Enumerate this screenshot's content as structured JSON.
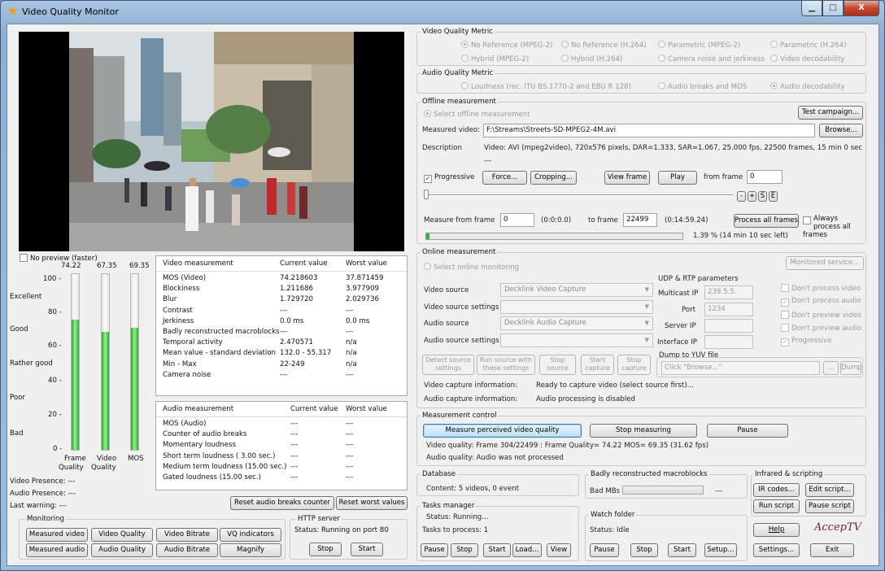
{
  "window": {
    "title": "Video Quality Monitor",
    "min": "▁",
    "max": "□",
    "close": "X"
  },
  "preview": {
    "no_preview_label": "No preview (faster)",
    "no_preview_checked": false
  },
  "gauges": {
    "values": [
      {
        "label": "74.22",
        "caption": "Frame Quality",
        "level": 0.7422
      },
      {
        "label": "67.35",
        "caption": "Video Quality",
        "level": 0.6735
      },
      {
        "label": "69.35",
        "caption": "MOS",
        "level": 0.6935
      }
    ],
    "ticks": [
      "100 -",
      "80 -",
      "60 -",
      "40 -",
      "20 -",
      "0 -"
    ],
    "bands": [
      "Excellent",
      "Good",
      "Rather good",
      "Poor",
      "Bad"
    ],
    "captions": {
      "frame": "Frame",
      "quality1": "Quality",
      "video": "Video",
      "quality2": "Quality",
      "mos": "MOS"
    }
  },
  "presence": {
    "video": "Video Presence:   ---",
    "audio": "Audio Presence:   ---",
    "warning": "Last warning:      ---"
  },
  "video_table": {
    "headers": [
      "Video measurement",
      "Current value",
      "Worst value"
    ],
    "rows": [
      [
        "MOS (Video)",
        "74.218603",
        "37.871459"
      ],
      [
        "Blockiness",
        "1.211686",
        "3.977909"
      ],
      [
        "Blur",
        "1.729720",
        "2.029736"
      ],
      [
        "Contrast",
        "---",
        "---"
      ],
      [
        "Jerkiness",
        "0.0 ms",
        "0.0 ms"
      ],
      [
        "Badly reconstructed macroblocks",
        "---",
        "---"
      ],
      [
        "Temporal activity",
        "2.470571",
        "n/a"
      ],
      [
        "Mean value - standard deviation",
        "132.0 - 55.317",
        "n/a"
      ],
      [
        "Min - Max",
        "22-249",
        "n/a"
      ],
      [
        "Camera noise",
        "---",
        "---"
      ]
    ]
  },
  "audio_table": {
    "headers": [
      "Audio measurement",
      "Current value",
      "Worst value"
    ],
    "rows": [
      [
        "MOS (Audio)",
        "---",
        "---"
      ],
      [
        "Counter of audio breaks",
        "---",
        "---"
      ],
      [
        "Momentary loudness",
        "---",
        "---"
      ],
      [
        "Short term loudness ( 3.00 sec.)",
        "---",
        "---"
      ],
      [
        "Medium term loudness (15.00 sec.)",
        "---",
        "---"
      ],
      [
        "Gated loudness (15.00 sec.)",
        "---",
        "---"
      ]
    ]
  },
  "reset": {
    "audio_breaks": "Reset audio breaks counter",
    "worst": "Reset worst values"
  },
  "monitoring": {
    "title": "Monitoring",
    "row1": [
      "Measured video",
      "Video Quality",
      "Video Bitrate",
      "VQ indicators"
    ],
    "row2": [
      "Measured audio",
      "Audio Quality",
      "Audio Bitrate",
      "Magnify"
    ]
  },
  "http": {
    "title": "HTTP server",
    "status": "Status:  Running on port 80",
    "stop": "Stop",
    "start": "Start"
  },
  "vqm": {
    "title": "Video Quality Metric",
    "options": [
      {
        "label": "No Reference (MPEG-2)",
        "on": true
      },
      {
        "label": "No Reference (H.264)",
        "on": false
      },
      {
        "label": "Parametric (MPEG-2)",
        "on": false
      },
      {
        "label": "Parametric (H.264)",
        "on": false
      },
      {
        "label": "Hybrid (MPEG-2)",
        "on": false
      },
      {
        "label": "Hybrid (H.264)",
        "on": false
      },
      {
        "label": "Camera noise and jerkiness",
        "on": false
      },
      {
        "label": "Video decodability",
        "on": false
      }
    ]
  },
  "aqm": {
    "title": "Audio Quality Metric",
    "options": [
      {
        "label": "Loudness (rec. ITU BS.1770-2 and EBU R 128)",
        "on": false
      },
      {
        "label": "Audio breaks and MOS",
        "on": false
      },
      {
        "label": "Audio decodability",
        "on": true
      }
    ]
  },
  "offline": {
    "title": "Offline measurement",
    "select": "Select offline measurement",
    "test_campaign": "Test campaign...",
    "measured_video_label": "Measured video:",
    "measured_video": "F:\\Streams\\Streets-SD-MPEG2-4M.avi",
    "browse": "Browse...",
    "description_label": "Description",
    "description": "Video: AVI (mpeg2video), 720x576 pixels, DAR=1.333, SAR=1.067,  25.000 fps, 22500 frames, 15 min 0 sec",
    "description2": "---",
    "progressive": "Progressive",
    "progressive_checked": true,
    "force": "Force...",
    "cropping": "Cropping...",
    "view_frame": "View frame",
    "play": "Play",
    "from_frame_label": "from frame",
    "from_frame": "0",
    "step_buttons": [
      "-",
      "+",
      "S",
      "E"
    ],
    "measure_from_label": "Measure from frame",
    "measure_from": "0",
    "measure_from_time": "(0:0:0.0)",
    "to_frame_label": "to frame",
    "to_frame": "22499",
    "to_time": "(0:14:59.24)",
    "process_all": "Process all frames",
    "always_process": "Always process all frames",
    "progress_text": "1.39 % (14 min 10 sec left)",
    "progress": 0.0139
  },
  "online": {
    "title": "Online measurement",
    "select": "Select online monitoring",
    "monitored_service": "Monitored service...",
    "video_source_label": "Video source",
    "video_source": "Decklink Video Capture",
    "video_settings_label": "Video source settings",
    "audio_source_label": "Audio source",
    "audio_source": "Decklink Audio Capture",
    "audio_settings_label": "Audio source settings",
    "udp_title": "UDP & RTP parameters",
    "multicast_label": "Multicast IP",
    "multicast": "239.5.5.",
    "port_label": "Port",
    "port": "1234",
    "server_label": "Server IP",
    "interface_label": "Interface IP",
    "checks": [
      {
        "label": "Don't process video",
        "on": false
      },
      {
        "label": "Don't process audio",
        "on": true
      },
      {
        "label": "Don't preview video",
        "on": false
      },
      {
        "label": "Don't preview audio",
        "on": false
      },
      {
        "label": "Progressive",
        "on": true
      }
    ],
    "detect": [
      "Detect source",
      "settings"
    ],
    "run": [
      "Run source with",
      "these settings"
    ],
    "stop": [
      "Stop",
      "source"
    ],
    "start_cap": [
      "Start",
      "capture"
    ],
    "stop_cap": [
      "Stop",
      "capture"
    ],
    "dump_title": "Dump to YUV file",
    "dump_placeholder": "Click \"Browse...\"",
    "dump_browse": "...",
    "dump": "Dump",
    "video_info_label": "Video capture information:",
    "video_info": "Ready to capture video (select source first)...",
    "audio_info_label": "Audio capture information:",
    "audio_info": "Audio processing is disabled"
  },
  "control": {
    "title": "Measurement control",
    "measure": "Measure perceived video quality",
    "stop": "Stop measuring",
    "pause": "Pause",
    "video_quality": "Video quality:  Frame 304/22499 : Frame Quality= 74.22 MOS= 69.35 (31.62 fps)",
    "audio_quality": "Audio quality:  Audio was not processed"
  },
  "database": {
    "title": "Database",
    "content": "Content:    5 videos, 0 event"
  },
  "macroblocks": {
    "title": "Badly reconstructed macroblocks",
    "label": "Bad MBs",
    "value": "---"
  },
  "tasks": {
    "title": "Tasks manager",
    "status": "Status:  Running...",
    "to_process": "Tasks to process:  1",
    "buttons": [
      "Pause",
      "Stop",
      "Start",
      "Load...",
      "View"
    ]
  },
  "watch": {
    "title": "Watch folder",
    "status": "Status:  Idle",
    "buttons": [
      "Pause",
      "Stop",
      "Start",
      "Setup..."
    ]
  },
  "scripting": {
    "title": "Infrared & scripting",
    "ir": "IR codes...",
    "edit": "Edit script...",
    "run": "Run script",
    "pause": "Pause script"
  },
  "footer": {
    "help": "Help",
    "logo": "AccepTV",
    "settings": "Settings...",
    "exit": "Exit"
  }
}
